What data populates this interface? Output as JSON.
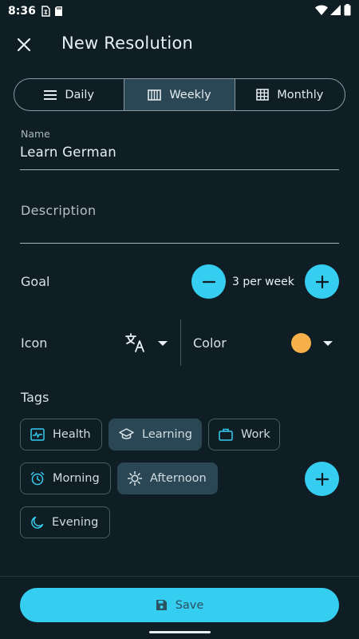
{
  "status_bar": {
    "time": "8:36"
  },
  "app_bar": {
    "title": "New Resolution"
  },
  "frequency": {
    "options": [
      {
        "label": "Daily",
        "icon": "list-icon"
      },
      {
        "label": "Weekly",
        "icon": "week-columns-icon"
      },
      {
        "label": "Monthly",
        "icon": "grid-icon"
      }
    ],
    "selected": "Weekly"
  },
  "name_field": {
    "label": "Name",
    "value": "Learn German"
  },
  "description_field": {
    "placeholder": "Description"
  },
  "goal": {
    "label": "Goal",
    "value": "3 per week"
  },
  "icon_picker": {
    "label": "Icon",
    "selected_icon": "translate-icon"
  },
  "color_picker": {
    "label": "Color",
    "selected_color": "#f6b04a"
  },
  "tags": {
    "label": "Tags",
    "items": [
      {
        "label": "Health",
        "icon": "health-monitor-icon",
        "selected": false
      },
      {
        "label": "Learning",
        "icon": "graduation-cap-icon",
        "selected": true
      },
      {
        "label": "Work",
        "icon": "briefcase-icon",
        "selected": false
      },
      {
        "label": "Morning",
        "icon": "alarm-clock-icon",
        "selected": false
      },
      {
        "label": "Afternoon",
        "icon": "sun-icon",
        "selected": true
      },
      {
        "label": "Evening",
        "icon": "moon-icon",
        "selected": false
      }
    ]
  },
  "save_button": {
    "label": "Save",
    "icon": "save-icon"
  },
  "colors": {
    "accent": "#35cdf0",
    "background": "#0f1d24",
    "selected_chip": "#2b4654"
  }
}
